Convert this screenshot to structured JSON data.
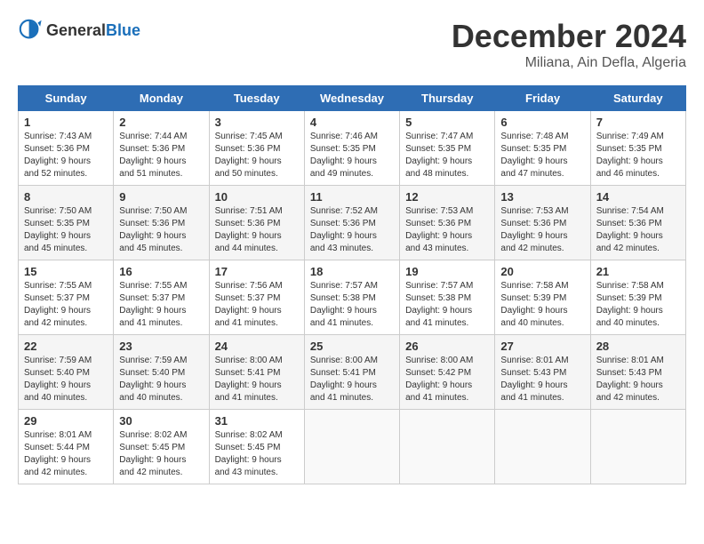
{
  "header": {
    "logo_general": "General",
    "logo_blue": "Blue",
    "month": "December 2024",
    "location": "Miliana, Ain Defla, Algeria"
  },
  "days_of_week": [
    "Sunday",
    "Monday",
    "Tuesday",
    "Wednesday",
    "Thursday",
    "Friday",
    "Saturday"
  ],
  "weeks": [
    [
      {
        "day": "1",
        "sunrise": "7:43 AM",
        "sunset": "5:36 PM",
        "daylight": "9 hours and 52 minutes."
      },
      {
        "day": "2",
        "sunrise": "7:44 AM",
        "sunset": "5:36 PM",
        "daylight": "9 hours and 51 minutes."
      },
      {
        "day": "3",
        "sunrise": "7:45 AM",
        "sunset": "5:36 PM",
        "daylight": "9 hours and 50 minutes."
      },
      {
        "day": "4",
        "sunrise": "7:46 AM",
        "sunset": "5:35 PM",
        "daylight": "9 hours and 49 minutes."
      },
      {
        "day": "5",
        "sunrise": "7:47 AM",
        "sunset": "5:35 PM",
        "daylight": "9 hours and 48 minutes."
      },
      {
        "day": "6",
        "sunrise": "7:48 AM",
        "sunset": "5:35 PM",
        "daylight": "9 hours and 47 minutes."
      },
      {
        "day": "7",
        "sunrise": "7:49 AM",
        "sunset": "5:35 PM",
        "daylight": "9 hours and 46 minutes."
      }
    ],
    [
      {
        "day": "8",
        "sunrise": "7:50 AM",
        "sunset": "5:35 PM",
        "daylight": "9 hours and 45 minutes."
      },
      {
        "day": "9",
        "sunrise": "7:50 AM",
        "sunset": "5:36 PM",
        "daylight": "9 hours and 45 minutes."
      },
      {
        "day": "10",
        "sunrise": "7:51 AM",
        "sunset": "5:36 PM",
        "daylight": "9 hours and 44 minutes."
      },
      {
        "day": "11",
        "sunrise": "7:52 AM",
        "sunset": "5:36 PM",
        "daylight": "9 hours and 43 minutes."
      },
      {
        "day": "12",
        "sunrise": "7:53 AM",
        "sunset": "5:36 PM",
        "daylight": "9 hours and 43 minutes."
      },
      {
        "day": "13",
        "sunrise": "7:53 AM",
        "sunset": "5:36 PM",
        "daylight": "9 hours and 42 minutes."
      },
      {
        "day": "14",
        "sunrise": "7:54 AM",
        "sunset": "5:36 PM",
        "daylight": "9 hours and 42 minutes."
      }
    ],
    [
      {
        "day": "15",
        "sunrise": "7:55 AM",
        "sunset": "5:37 PM",
        "daylight": "9 hours and 42 minutes."
      },
      {
        "day": "16",
        "sunrise": "7:55 AM",
        "sunset": "5:37 PM",
        "daylight": "9 hours and 41 minutes."
      },
      {
        "day": "17",
        "sunrise": "7:56 AM",
        "sunset": "5:37 PM",
        "daylight": "9 hours and 41 minutes."
      },
      {
        "day": "18",
        "sunrise": "7:57 AM",
        "sunset": "5:38 PM",
        "daylight": "9 hours and 41 minutes."
      },
      {
        "day": "19",
        "sunrise": "7:57 AM",
        "sunset": "5:38 PM",
        "daylight": "9 hours and 41 minutes."
      },
      {
        "day": "20",
        "sunrise": "7:58 AM",
        "sunset": "5:39 PM",
        "daylight": "9 hours and 40 minutes."
      },
      {
        "day": "21",
        "sunrise": "7:58 AM",
        "sunset": "5:39 PM",
        "daylight": "9 hours and 40 minutes."
      }
    ],
    [
      {
        "day": "22",
        "sunrise": "7:59 AM",
        "sunset": "5:40 PM",
        "daylight": "9 hours and 40 minutes."
      },
      {
        "day": "23",
        "sunrise": "7:59 AM",
        "sunset": "5:40 PM",
        "daylight": "9 hours and 40 minutes."
      },
      {
        "day": "24",
        "sunrise": "8:00 AM",
        "sunset": "5:41 PM",
        "daylight": "9 hours and 41 minutes."
      },
      {
        "day": "25",
        "sunrise": "8:00 AM",
        "sunset": "5:41 PM",
        "daylight": "9 hours and 41 minutes."
      },
      {
        "day": "26",
        "sunrise": "8:00 AM",
        "sunset": "5:42 PM",
        "daylight": "9 hours and 41 minutes."
      },
      {
        "day": "27",
        "sunrise": "8:01 AM",
        "sunset": "5:43 PM",
        "daylight": "9 hours and 41 minutes."
      },
      {
        "day": "28",
        "sunrise": "8:01 AM",
        "sunset": "5:43 PM",
        "daylight": "9 hours and 42 minutes."
      }
    ],
    [
      {
        "day": "29",
        "sunrise": "8:01 AM",
        "sunset": "5:44 PM",
        "daylight": "9 hours and 42 minutes."
      },
      {
        "day": "30",
        "sunrise": "8:02 AM",
        "sunset": "5:45 PM",
        "daylight": "9 hours and 42 minutes."
      },
      {
        "day": "31",
        "sunrise": "8:02 AM",
        "sunset": "5:45 PM",
        "daylight": "9 hours and 43 minutes."
      },
      null,
      null,
      null,
      null
    ]
  ]
}
